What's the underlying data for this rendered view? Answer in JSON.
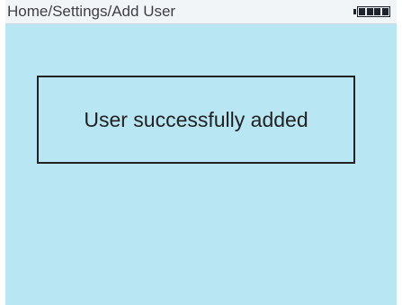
{
  "header": {
    "breadcrumb": "Home/Settings/Add User",
    "battery_icon": "battery-full-icon",
    "battery_level": 1.0
  },
  "dialog": {
    "message": "User successfully added"
  },
  "colors": {
    "screen_background": "#b9e6f3",
    "statusbar_background": "#f2f5f8",
    "text": "#222222"
  }
}
